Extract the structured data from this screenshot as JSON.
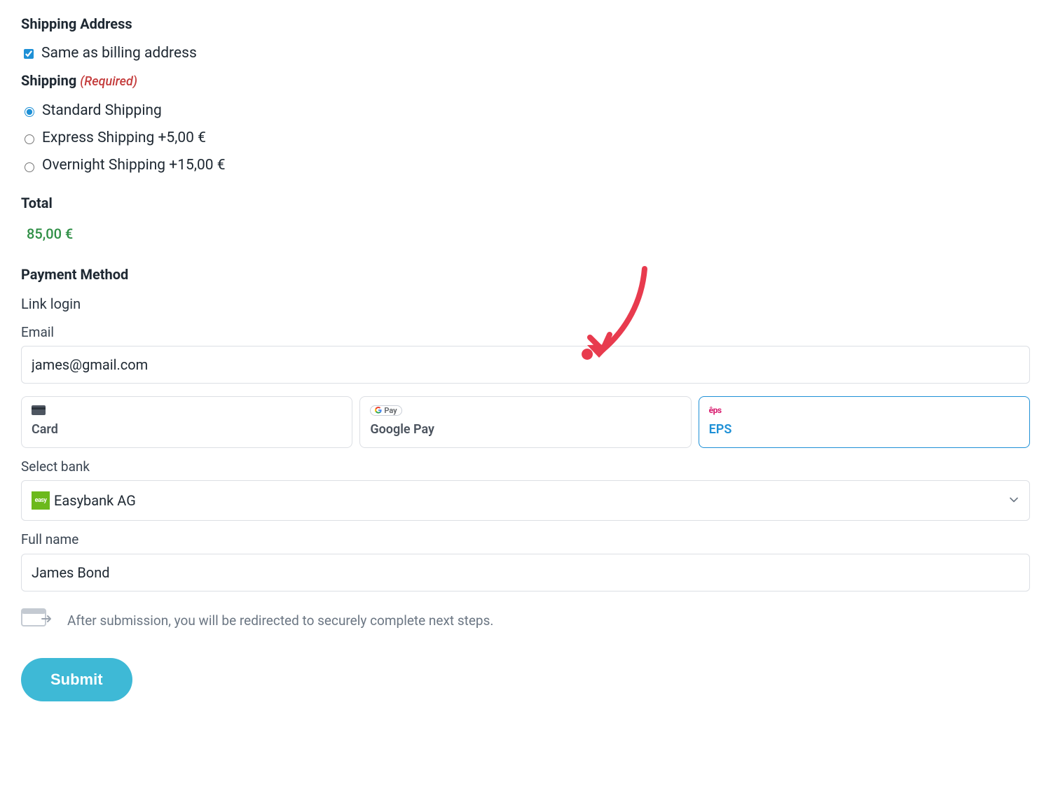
{
  "shipping_address": {
    "title": "Shipping Address",
    "same_as_billing_label": "Same as billing address",
    "same_as_billing_checked": true
  },
  "shipping": {
    "title": "Shipping",
    "required_label": "(Required)",
    "options": [
      {
        "key": "standard",
        "label": "Standard Shipping",
        "checked": true
      },
      {
        "key": "express",
        "label": "Express Shipping +5,00 €",
        "checked": false
      },
      {
        "key": "overnight",
        "label": "Overnight Shipping +15,00 €",
        "checked": false
      }
    ]
  },
  "total": {
    "title": "Total",
    "value": "85,00 €"
  },
  "payment": {
    "title": "Payment Method",
    "link_login_label": "Link login",
    "email_label": "Email",
    "email_value": "james@gmail.com",
    "tabs": [
      {
        "key": "card",
        "label": "Card",
        "selected": false
      },
      {
        "key": "gpay",
        "label": "Google Pay",
        "selected": false
      },
      {
        "key": "eps",
        "label": "EPS",
        "selected": true
      }
    ],
    "select_bank_label": "Select bank",
    "bank_name": "Easybank AG",
    "bank_badge_text": "easy",
    "full_name_label": "Full name",
    "full_name_value": "James Bond",
    "redirect_notice": "After submission, you will be redirected to securely complete next steps."
  },
  "submit_label": "Submit",
  "annotation": {
    "arrow_target_description": "red hand-drawn arrow pointing to EPS payment tab"
  }
}
